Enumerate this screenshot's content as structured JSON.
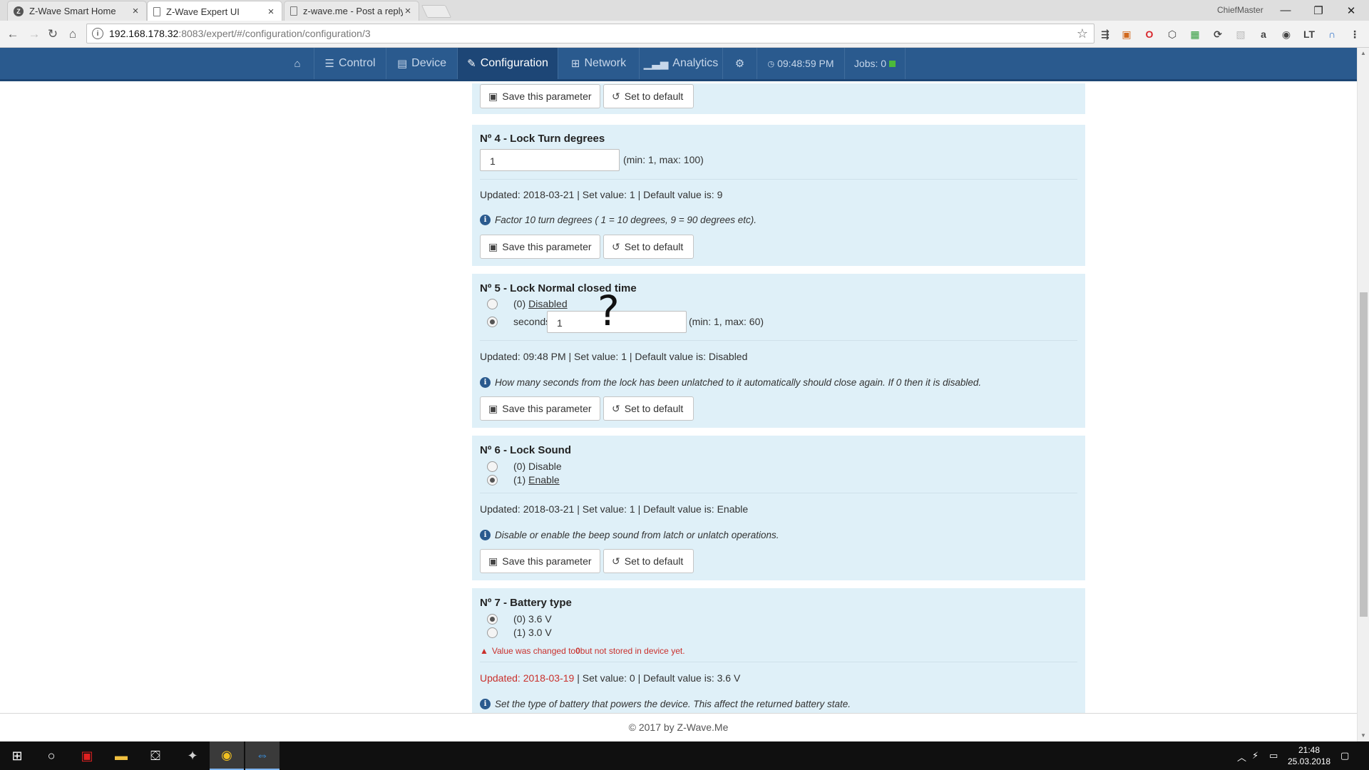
{
  "browser": {
    "tabs": [
      {
        "title": "Z-Wave Smart Home",
        "favicon": "z-icon"
      },
      {
        "title": "Z-Wave Expert UI",
        "favicon": "page-icon"
      },
      {
        "title": "z-wave.me - Post a reply",
        "favicon": "page-icon"
      }
    ],
    "profile": "ChiefMaster",
    "url_host": "192.168.178.32",
    "url_rest": ":8083/expert/#/configuration/configuration/3"
  },
  "nav": {
    "control": "Control",
    "device": "Device",
    "configuration": "Configuration",
    "network": "Network",
    "analytics": "Analytics",
    "time": "09:48:59 PM",
    "jobs": "Jobs: 0"
  },
  "buttons": {
    "save": "Save this parameter",
    "default": "Set to default"
  },
  "params": {
    "p4": {
      "title": "Nº 4 - Lock Turn degrees",
      "value": "1",
      "range": "(min: 1, max: 100)",
      "updated": "Updated: 2018-03-21 | Set value: 1 | Default value is: 9",
      "desc": "Factor 10 turn degrees ( 1 = 10 degrees, 9 = 90 degrees etc)."
    },
    "p5": {
      "title": "Nº 5 - Lock Normal closed time",
      "opt0_prefix": "(0)",
      "opt0_label": "Disabled",
      "opt1_label": "seconds",
      "value": "1",
      "range": "(min: 1, max: 60)",
      "updated": "Updated: 09:48 PM | Set value: 1 | Default value is: Disabled",
      "desc": "How many seconds from the lock has been unlatched to it automatically should close again. If 0 then it is disabled."
    },
    "p6": {
      "title": "Nº 6 - Lock Sound",
      "opt0": "(0) Disable",
      "opt1_prefix": "(1)",
      "opt1_label": "Enable",
      "updated": "Updated: 2018-03-21 | Set value: 1 | Default value is: Enable",
      "desc": "Disable or enable the beep sound from latch or unlatch operations."
    },
    "p7": {
      "title": "Nº 7 - Battery type",
      "opt0": "(0) 3.6 V",
      "opt1": "(1) 3.0 V",
      "warn_pre": "Value was changed to ",
      "warn_val": "0",
      "warn_post": " but not stored in device yet.",
      "updated_date": "Updated: 2018-03-19",
      "updated_rest": " | Set value: 0 | Default value is: 3.6 V",
      "desc": "Set the type of battery that powers the device. This affect the returned battery state."
    }
  },
  "annotation": "?",
  "footer": "© 2017 by Z-Wave.Me",
  "taskbar": {
    "time": "21:48",
    "date": "25.03.2018"
  }
}
